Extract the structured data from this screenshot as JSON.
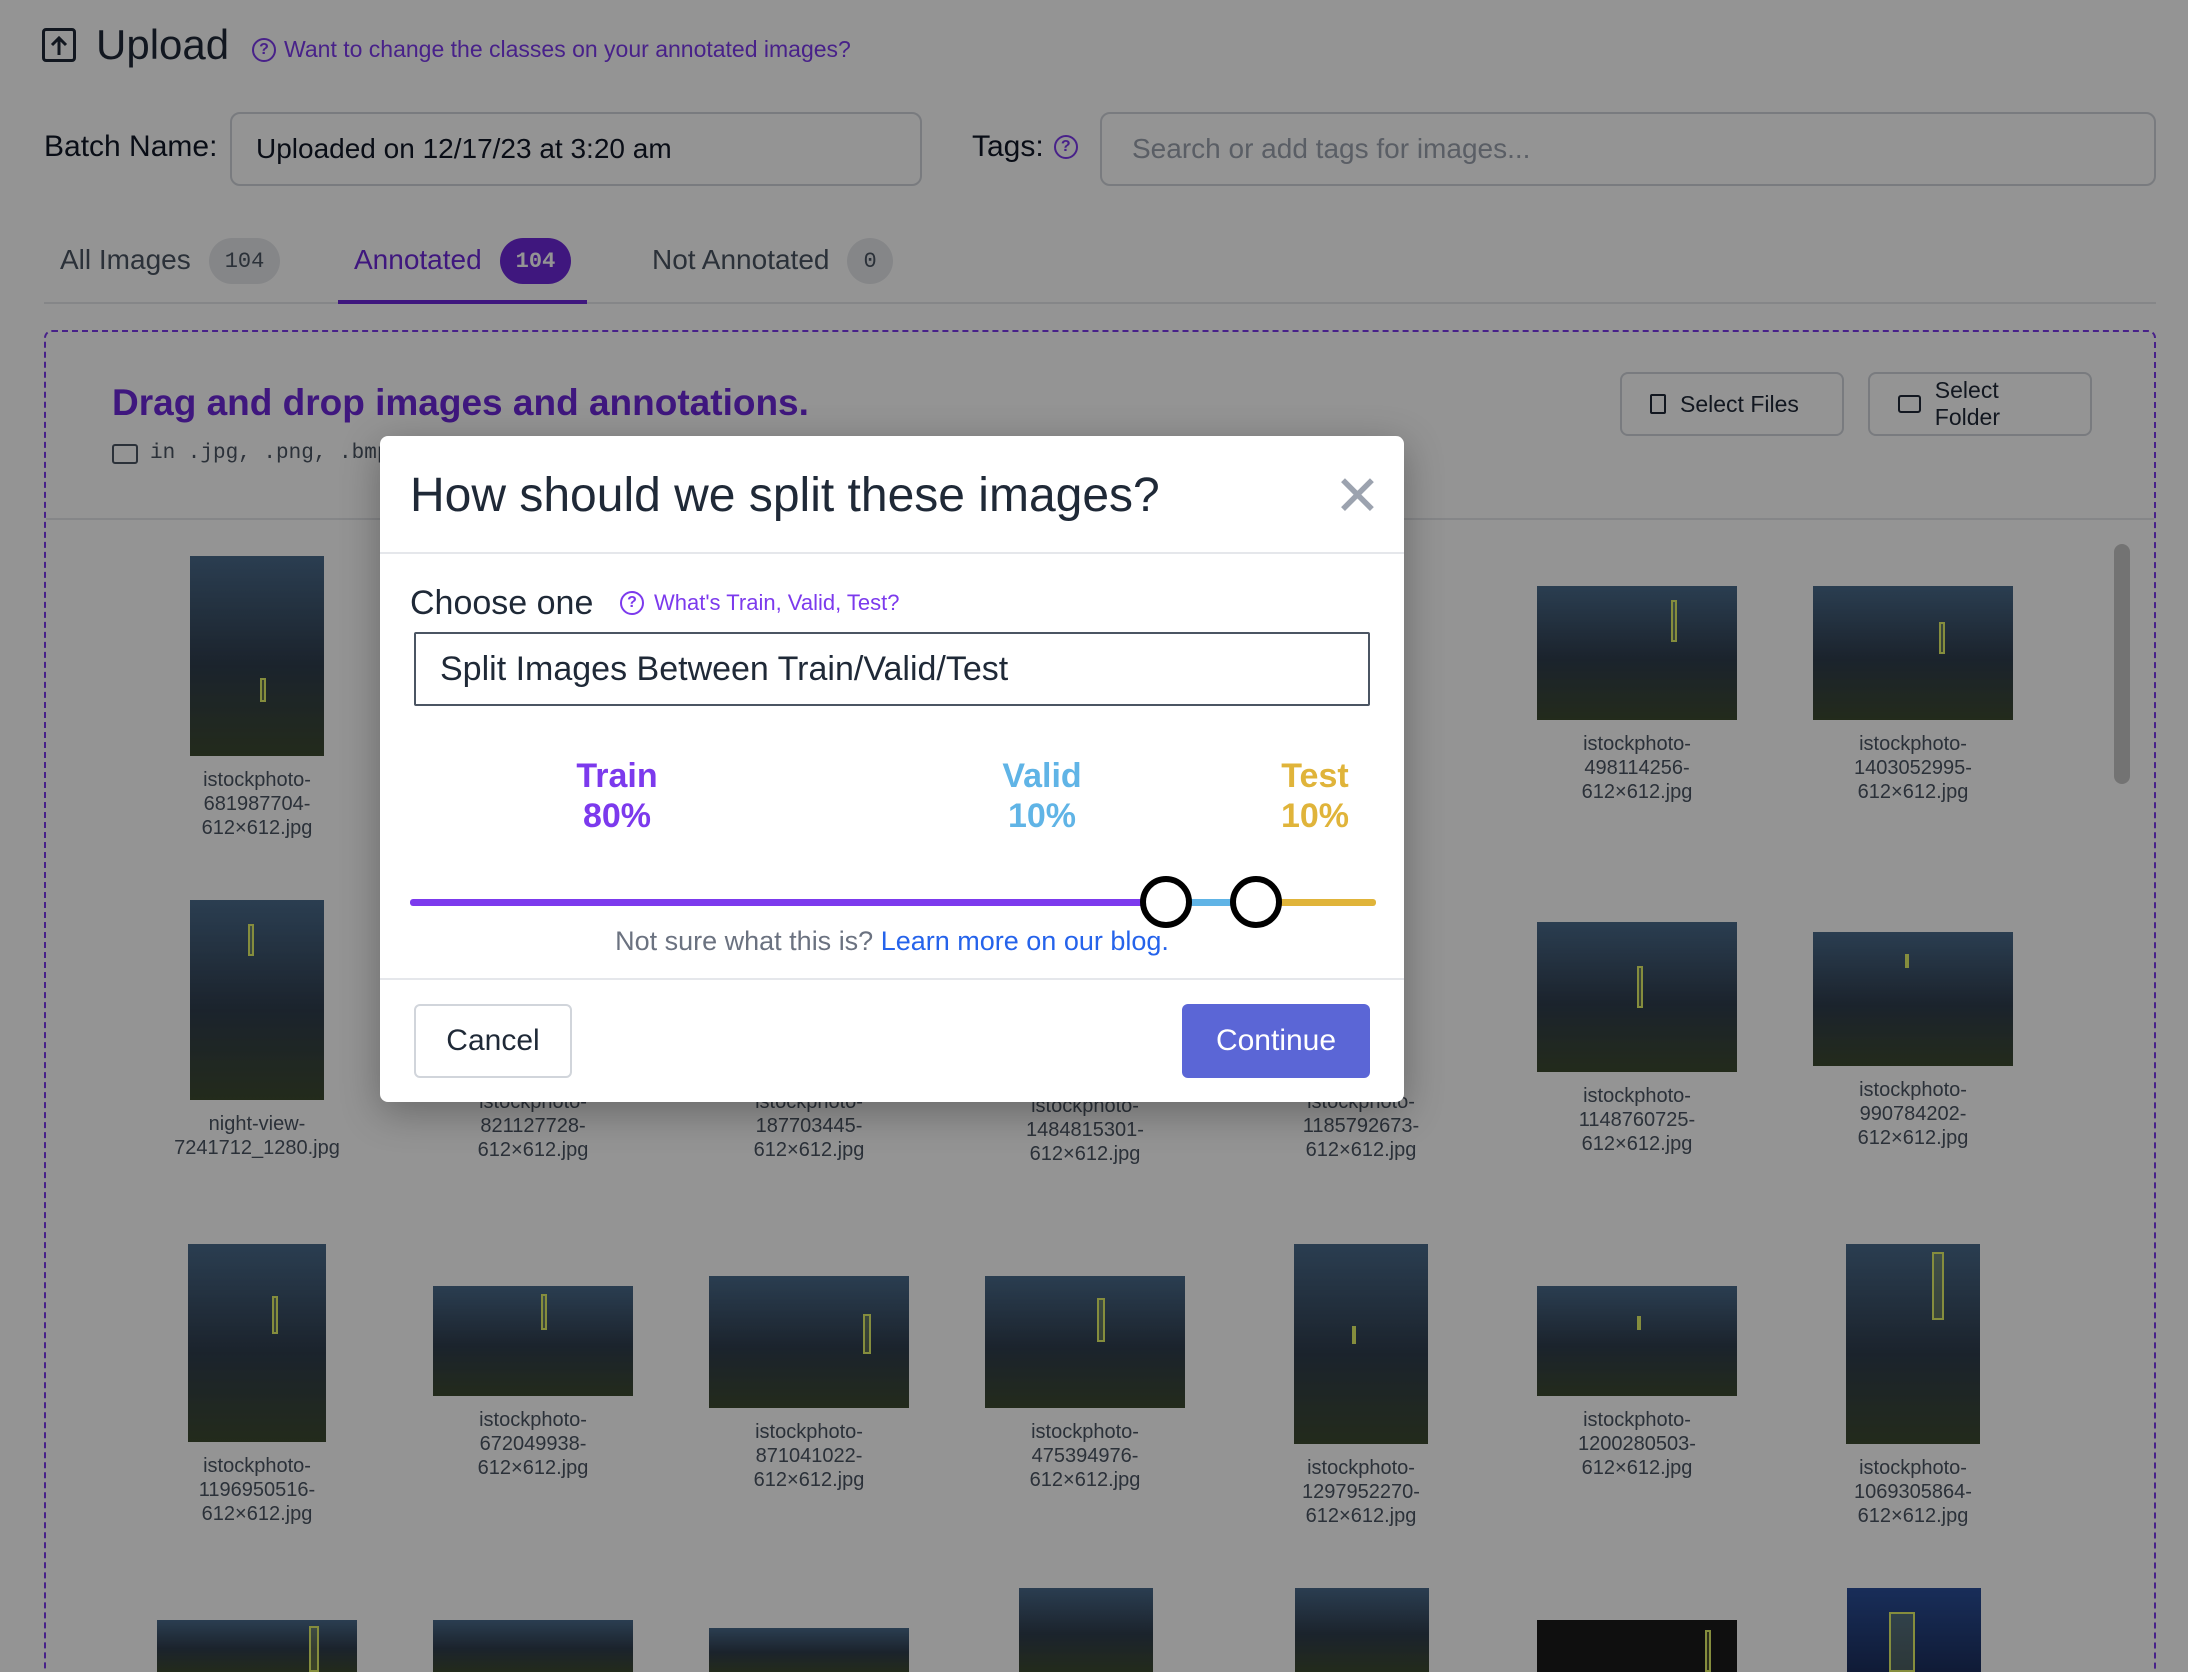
{
  "header": {
    "title": "Upload",
    "help_link": "Want to change the classes on your annotated images?"
  },
  "batch": {
    "label": "Batch Name:",
    "value": "Uploaded on 12/17/23 at 3:20 am"
  },
  "tags": {
    "label": "Tags:",
    "placeholder": "Search or add tags for images..."
  },
  "tabs": [
    {
      "label": "All Images",
      "count": "104"
    },
    {
      "label": "Annotated",
      "count": "104"
    },
    {
      "label": "Not Annotated",
      "count": "0"
    }
  ],
  "dropzone": {
    "title": "Drag and drop images and annotations.",
    "formats": "in .jpg, .png, .bmp",
    "select_files": "Select Files",
    "select_folder": "Select Folder"
  },
  "images": [
    {
      "name": [
        "istockphoto-",
        "681987704-",
        "612×612.jpg"
      ]
    },
    {
      "name": [
        "istockphoto-",
        "498114256-",
        "612×612.jpg"
      ]
    },
    {
      "name": [
        "istockphoto-",
        "1403052995-",
        "612×612.jpg"
      ]
    },
    {
      "name": [
        "night-view-",
        "7241712_1280.jpg"
      ]
    },
    {
      "name": [
        "istockphoto-",
        "821127728-",
        "612×612.jpg"
      ]
    },
    {
      "name": [
        "istockphoto-",
        "187703445-",
        "612×612.jpg"
      ]
    },
    {
      "name": [
        "istockphoto-",
        "1484815301-",
        "612×612.jpg"
      ]
    },
    {
      "name": [
        "istockphoto-",
        "1185792673-",
        "612×612.jpg"
      ]
    },
    {
      "name": [
        "istockphoto-",
        "1148760725-",
        "612×612.jpg"
      ]
    },
    {
      "name": [
        "istockphoto-",
        "990784202-",
        "612×612.jpg"
      ]
    },
    {
      "name": [
        "istockphoto-",
        "1196950516-",
        "612×612.jpg"
      ]
    },
    {
      "name": [
        "istockphoto-",
        "672049938-",
        "612×612.jpg"
      ]
    },
    {
      "name": [
        "istockphoto-",
        "871041022-",
        "612×612.jpg"
      ]
    },
    {
      "name": [
        "istockphoto-",
        "475394976-",
        "612×612.jpg"
      ]
    },
    {
      "name": [
        "istockphoto-",
        "1297952270-",
        "612×612.jpg"
      ]
    },
    {
      "name": [
        "istockphoto-",
        "1200280503-",
        "612×612.jpg"
      ]
    },
    {
      "name": [
        "istockphoto-",
        "1069305864-",
        "612×612.jpg"
      ]
    }
  ],
  "modal": {
    "title": "How should we split these images?",
    "close": "✕",
    "choose_label": "Choose one",
    "choose_help": "What's Train, Valid, Test?",
    "selected_option": "Split Images Between Train/Valid/Test",
    "train_label": "Train",
    "train_pct": "80%",
    "valid_label": "Valid",
    "valid_pct": "10%",
    "test_label": "Test",
    "test_pct": "10%",
    "not_sure_text": "Not sure what this is?",
    "learn_more": "Learn more on our blog.",
    "cancel": "Cancel",
    "continue": "Continue"
  },
  "colors": {
    "accent": "#6d28d9",
    "train": "#7c3aed",
    "valid": "#60b4e6",
    "test": "#e0b43a",
    "continue": "#5b66d6"
  }
}
